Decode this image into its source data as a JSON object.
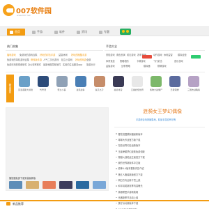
{
  "site": {
    "name": "007软件园",
    "url": "www.007.net"
  },
  "nav": {
    "items": [
      {
        "label": "首页"
      },
      {
        "label": "手游"
      },
      {
        "label": "软件"
      },
      {
        "label": "资讯"
      },
      {
        "label": "专题"
      }
    ]
  },
  "hot": {
    "title": "热门合集",
    "rows": [
      [
        "福利游戏",
        "免费玩的游戏合集",
        "好玩的射击手游",
        "益智休闲",
        "好玩的跑酷手游"
      ],
      [
        "免费玩的单机游戏合集",
        "修改版手游",
        "人气二次元游戏",
        "独立小游戏",
        "好玩的网游",
        "全部"
      ],
      [
        "免费好用的视频软件",
        "办公效率软件",
        "最新地图导航软件",
        "实用的生活服务app",
        "旅游出行"
      ]
    ]
  },
  "boutique": {
    "title": "手游大全",
    "rows": [
      [
        "冒险游戏",
        "角色扮演",
        "射击游戏",
        "赛车竞速",
        "动作游戏",
        "休闲益智",
        "模拟经营"
      ],
      [
        "体育竞技",
        "策略塔防",
        "卡牌游戏",
        "飞行射击",
        "音乐游戏"
      ],
      [
        "益智游戏",
        "战争策略",
        "模拟器",
        "棋牌游戏"
      ]
    ]
  },
  "side_tab": "精品推荐",
  "apps": [
    {
      "name": "克洛诺斯大冒险",
      "color": "#6aa0c8"
    },
    {
      "name": "代号鸢",
      "color": "#2d4c7a"
    },
    {
      "name": "聚立小事",
      "color": "#8fa1b6"
    },
    {
      "name": "皇家战争",
      "color": "#4a7fb5"
    },
    {
      "name": "鬼灭之刃",
      "color": "#c68d6a"
    },
    {
      "name": "秘境寻宝",
      "color": "#3a3a55"
    },
    {
      "name": "口袋妖怪世界",
      "color": "#e8e8e8"
    },
    {
      "name": "植物大战僵尸",
      "color": "#7cb86a"
    },
    {
      "name": "王者荣耀",
      "color": "#5b6b9e"
    },
    {
      "name": "三国志战略版",
      "color": "#b6a2c5"
    }
  ],
  "banner": {
    "caption": "播放器免费下载安装最新版",
    "thumb_colors": [
      "#5d8db8",
      "#d8b070",
      "#e87e5a",
      "#3c3c5c",
      "#2a6aa0",
      "#7aa8d8"
    ]
  },
  "promo": {
    "title": "涟漪女王梦幻偶像",
    "subtitle": "手游综合玩家聚集地，精品手游应有尽有"
  },
  "news": [
    "樱花校园模拟器最新版本",
    "球球大作战官方版下载",
    "坦克世界闪击战新版本",
    "王者荣耀梦幻皮肤免费领取",
    "穿越火线枪战王者官方下载",
    "我的世界新版本中文版",
    "原神4.4版本更新内容介绍",
    "第五人格最新版官方下载",
    "明日方舟全新干员上线",
    "和平精英新赛季内容曝光",
    "英雄联盟手游新英雄",
    "光遇新季节活动上线",
    "蛋仔派对新版本下载",
    "QQ飞车手游新赛车",
    "崩坏星穹铁道最新版"
  ],
  "bottom": {
    "title": "新品推荐"
  },
  "colors": {
    "accent": "#f39c12",
    "red": "#e74c3c",
    "green": "#2ecc71",
    "link": "#3a8bd8"
  }
}
